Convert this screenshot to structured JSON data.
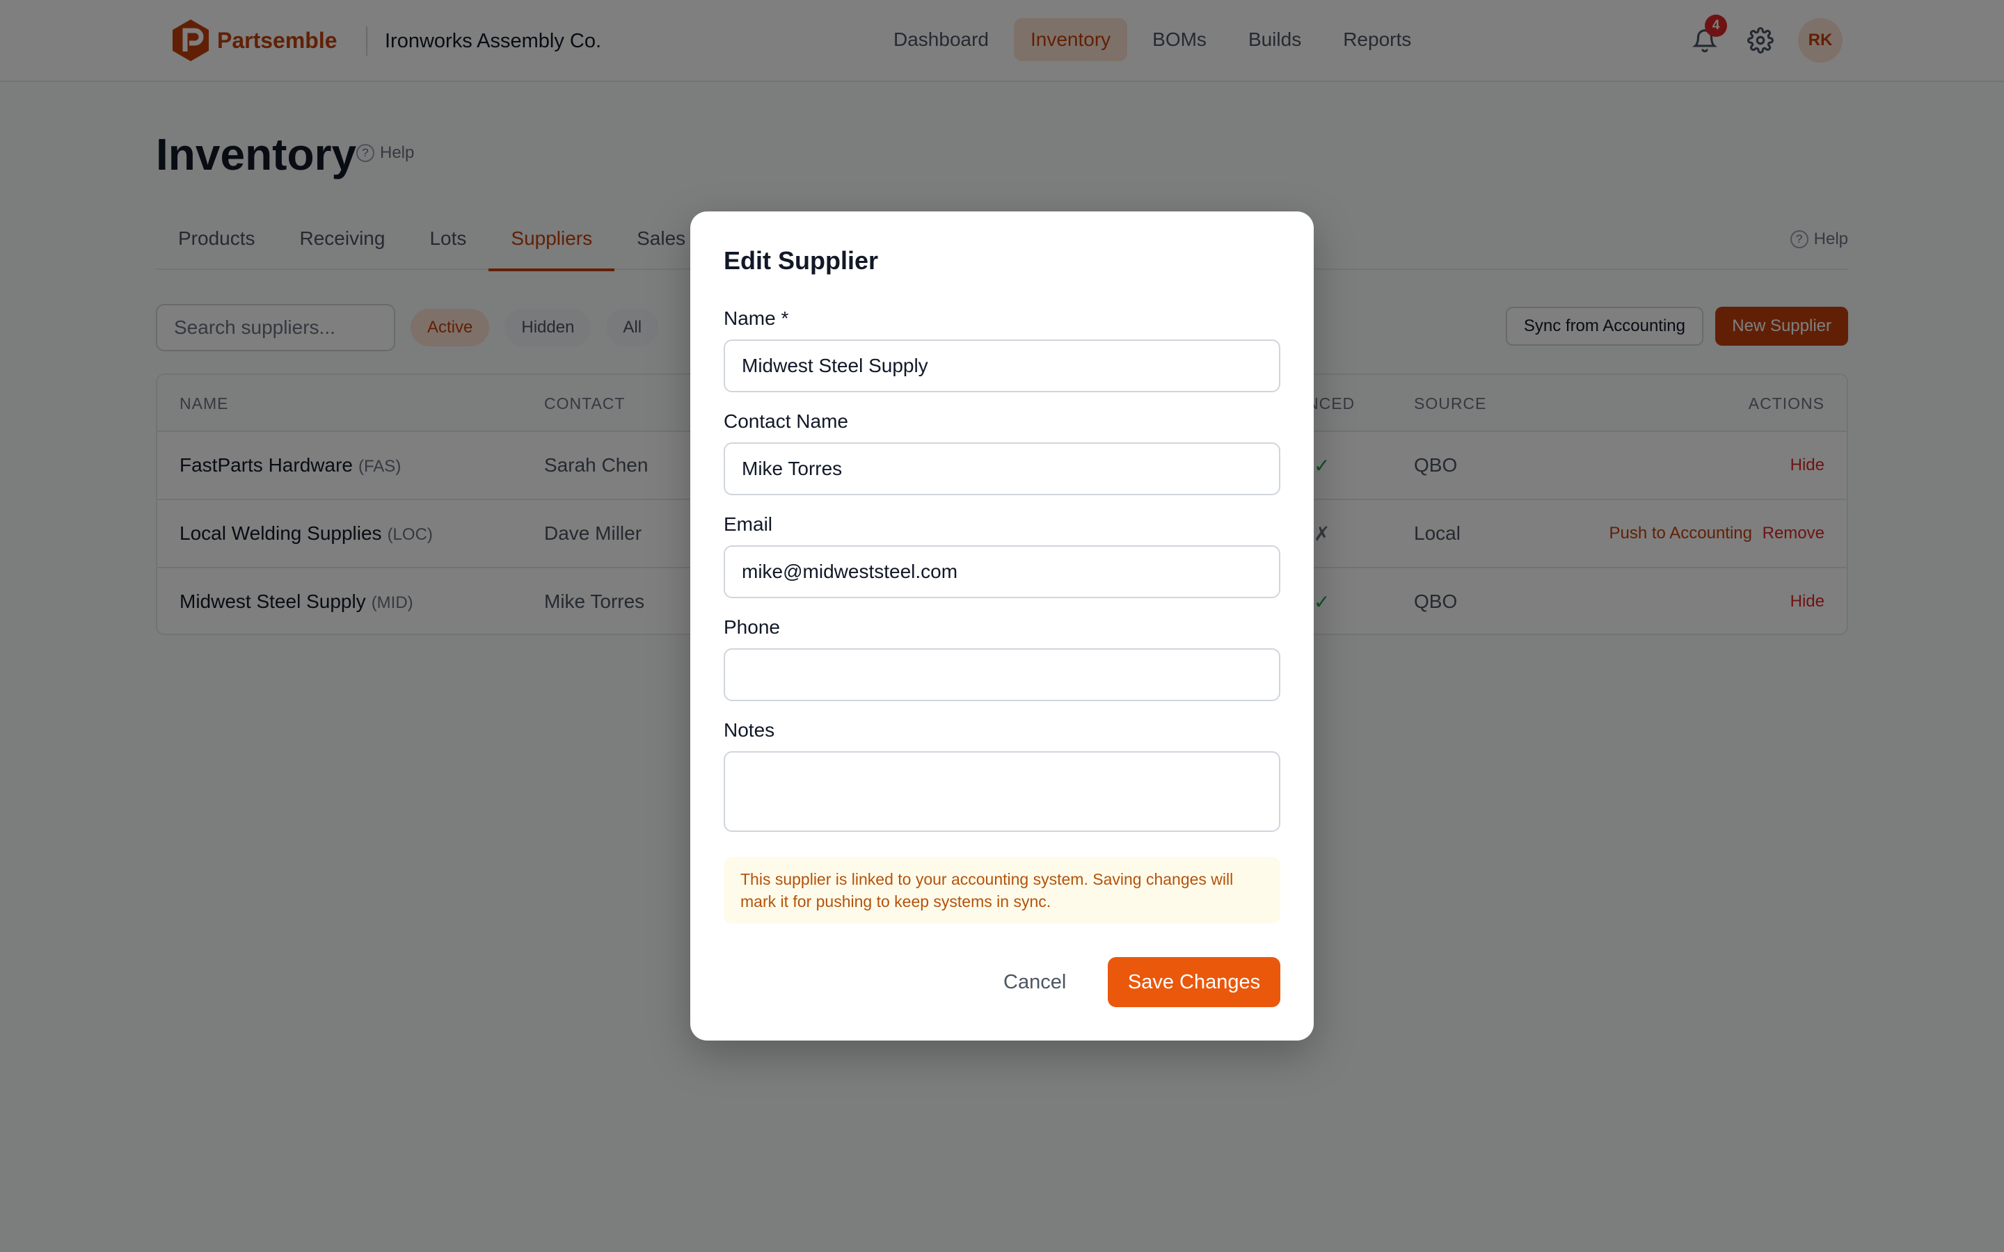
{
  "brand": {
    "name": "Partsemble",
    "accent": "#c2410c"
  },
  "org_name": "Ironworks Assembly Co.",
  "nav": {
    "items": [
      "Dashboard",
      "Inventory",
      "BOMs",
      "Builds",
      "Reports"
    ],
    "active": "Inventory"
  },
  "header": {
    "notification_count": "4",
    "avatar_initials": "RK"
  },
  "page": {
    "title": "Inventory",
    "help": "Help"
  },
  "tabs": {
    "items": [
      "Products",
      "Receiving",
      "Lots",
      "Suppliers",
      "Sales"
    ],
    "active": "Suppliers",
    "help": "Help"
  },
  "toolbar": {
    "search_placeholder": "Search suppliers...",
    "filters": [
      "Active",
      "Hidden",
      "All"
    ],
    "sync_label": "Sync from Accounting",
    "new_label": "New Supplier"
  },
  "table": {
    "columns": {
      "name": "NAME",
      "contact": "CONTACT",
      "synced": "NCED",
      "source": "SOURCE",
      "actions": "ACTIONS"
    },
    "rows": [
      {
        "name": "FastParts Hardware",
        "code": "(FAS)",
        "contact": "Sarah Chen",
        "synced": "✓",
        "source": "QBO",
        "actions": [
          "Hide"
        ]
      },
      {
        "name": "Local Welding Supplies",
        "code": "(LOC)",
        "contact": "Dave Miller",
        "synced": "✗",
        "source": "Local",
        "actions": [
          "Push to Accounting",
          "Remove"
        ]
      },
      {
        "name": "Midwest Steel Supply",
        "code": "(MID)",
        "contact": "Mike Torres",
        "synced": "✓",
        "source": "QBO",
        "actions": [
          "Hide"
        ]
      }
    ]
  },
  "modal": {
    "title": "Edit Supplier",
    "fields": {
      "name": {
        "label": "Name *",
        "value": "Midwest Steel Supply"
      },
      "contact": {
        "label": "Contact Name",
        "value": "Mike Torres"
      },
      "email": {
        "label": "Email",
        "value": "mike@midweststeel.com"
      },
      "phone": {
        "label": "Phone",
        "value": ""
      },
      "notes": {
        "label": "Notes",
        "value": ""
      }
    },
    "notice": "This supplier is linked to your accounting system. Saving changes will mark it for pushing to keep systems in sync.",
    "cancel_label": "Cancel",
    "save_label": "Save Changes"
  }
}
